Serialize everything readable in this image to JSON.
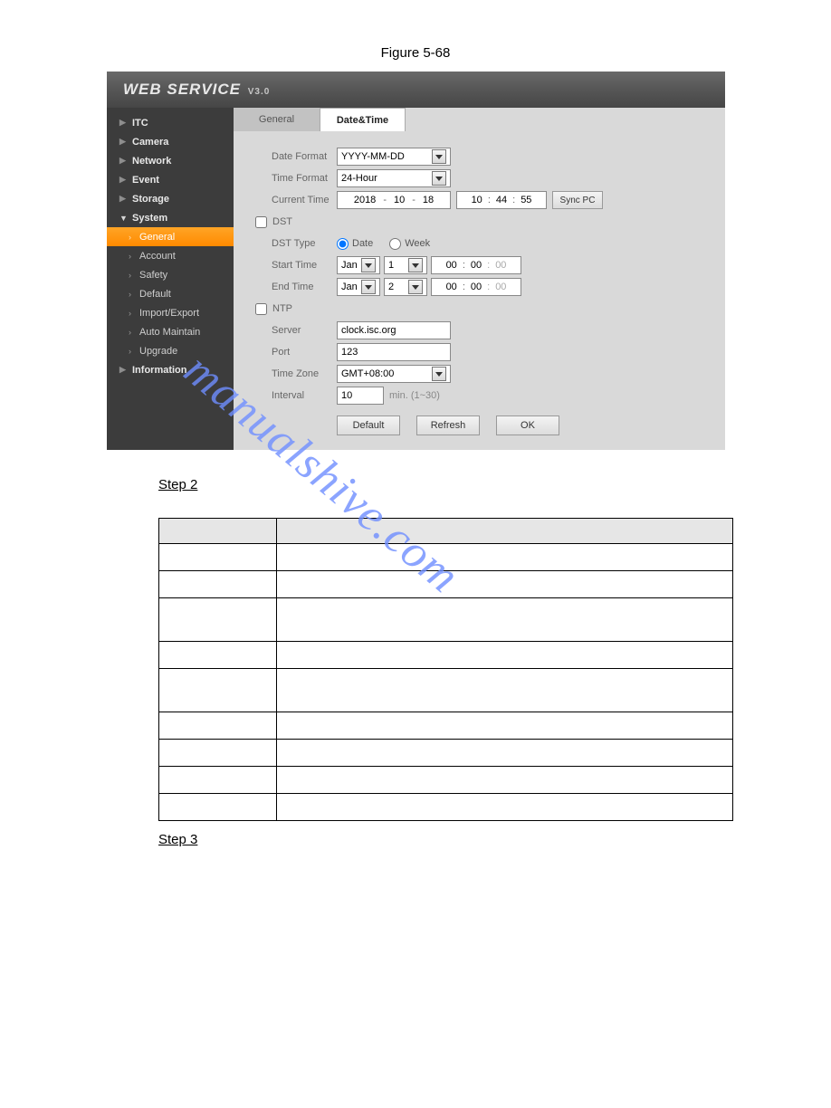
{
  "figure_title": "Figure 5-68",
  "logo": {
    "main": "WEB  SERVICE",
    "ver": "V3.0"
  },
  "sidebar": {
    "items": [
      {
        "label": "ITC",
        "expanded": false
      },
      {
        "label": "Camera",
        "expanded": false
      },
      {
        "label": "Network",
        "expanded": false
      },
      {
        "label": "Event",
        "expanded": false
      },
      {
        "label": "Storage",
        "expanded": false
      },
      {
        "label": "System",
        "expanded": true,
        "children": [
          {
            "label": "General",
            "active": true
          },
          {
            "label": "Account"
          },
          {
            "label": "Safety"
          },
          {
            "label": "Default"
          },
          {
            "label": "Import/Export"
          },
          {
            "label": "Auto Maintain"
          },
          {
            "label": "Upgrade"
          }
        ]
      },
      {
        "label": "Information",
        "expanded": false
      }
    ]
  },
  "tabs": [
    {
      "label": "General",
      "active": false
    },
    {
      "label": "Date&Time",
      "active": true
    }
  ],
  "form": {
    "date_format": {
      "label": "Date Format",
      "value": "YYYY-MM-DD"
    },
    "time_format": {
      "label": "Time Format",
      "value": "24-Hour"
    },
    "current_time": {
      "label": "Current Time",
      "year": "2018",
      "month": "10",
      "day": "18",
      "hour": "10",
      "minute": "44",
      "second": "55",
      "sync_btn": "Sync PC"
    },
    "dst": {
      "label": "DST",
      "checked": false
    },
    "dst_type": {
      "label": "DST Type",
      "options": [
        "Date",
        "Week"
      ],
      "selected": "Date"
    },
    "start_time": {
      "label": "Start Time",
      "month": "Jan",
      "day": "1",
      "h": "00",
      "m": "00",
      "s": "00"
    },
    "end_time": {
      "label": "End Time",
      "month": "Jan",
      "day": "2",
      "h": "00",
      "m": "00",
      "s": "00"
    },
    "ntp": {
      "label": "NTP",
      "checked": false
    },
    "server": {
      "label": "Server",
      "value": "clock.isc.org"
    },
    "port": {
      "label": "Port",
      "value": "123"
    },
    "time_zone": {
      "label": "Time Zone",
      "value": "GMT+08:00"
    },
    "interval": {
      "label": "Interval",
      "value": "10",
      "hint": "min. (1~30)"
    },
    "buttons": {
      "default": "Default",
      "refresh": "Refresh",
      "ok": "OK"
    }
  },
  "doc": {
    "step2": "Step 2",
    "step3": "Step 3",
    "watermark": "manualshive.com"
  }
}
